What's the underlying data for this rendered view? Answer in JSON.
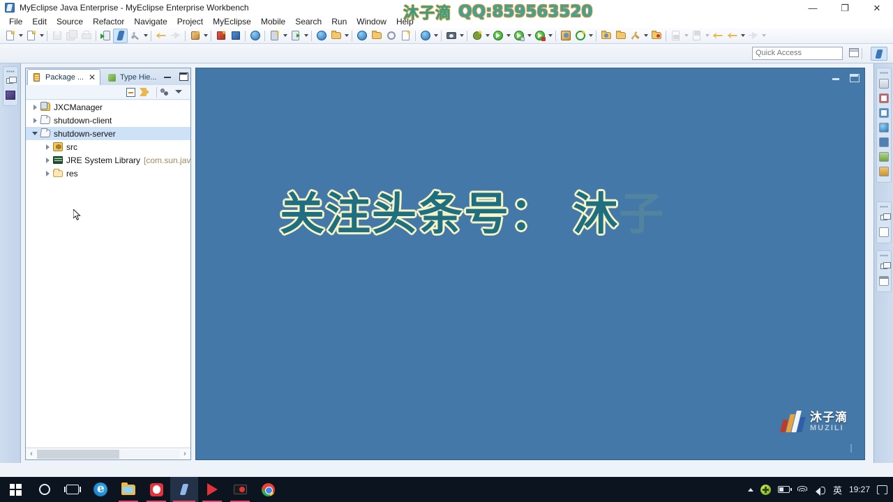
{
  "window": {
    "title": "MyEclipse Java Enterprise - MyEclipse Enterprise Workbench",
    "app_icon": "myeclipse-icon",
    "minimize": "—",
    "maximize": "❐",
    "close": "✕"
  },
  "watermark": {
    "cn": "沐子滴",
    "qq": "QQ:859563520"
  },
  "menubar": {
    "items": [
      "File",
      "Edit",
      "Source",
      "Refactor",
      "Navigate",
      "Project",
      "MyEclipse",
      "Mobile",
      "Search",
      "Run",
      "Window",
      "Help"
    ]
  },
  "toolbar": {
    "groups": [
      {
        "buttons": [
          {
            "name": "new-wizard",
            "icon": "new-file-icon",
            "caret": true,
            "selected": false,
            "disabled": false
          },
          {
            "name": "new-java-file",
            "icon": "new-doc-icon",
            "caret": true,
            "selected": false,
            "disabled": false
          }
        ]
      },
      {
        "buttons": [
          {
            "name": "save",
            "icon": "save-icon",
            "caret": false,
            "selected": false,
            "disabled": true
          },
          {
            "name": "save-all",
            "icon": "save-all-icon",
            "caret": false,
            "selected": false,
            "disabled": true
          },
          {
            "name": "print",
            "icon": "print-icon",
            "caret": false,
            "selected": false,
            "disabled": true
          }
        ]
      },
      {
        "buttons": [
          {
            "name": "run-deploy",
            "icon": "deploy-icon",
            "caret": false,
            "selected": false,
            "disabled": false
          },
          {
            "name": "myeclipse-tools",
            "icon": "myeclipse-icon",
            "caret": false,
            "selected": true,
            "disabled": false
          },
          {
            "name": "build",
            "icon": "hammer-icon",
            "caret": true,
            "selected": false,
            "disabled": false
          }
        ]
      },
      {
        "buttons": [
          {
            "name": "undo",
            "icon": "undo-arrow-icon",
            "caret": false,
            "selected": false,
            "disabled": false
          },
          {
            "name": "redo",
            "icon": "redo-arrow-icon",
            "caret": false,
            "selected": false,
            "disabled": true
          }
        ]
      },
      {
        "buttons": [
          {
            "name": "new-package",
            "icon": "package-new-icon",
            "caret": true,
            "selected": false,
            "disabled": false
          }
        ]
      },
      {
        "buttons": [
          {
            "name": "export-red",
            "icon": "package-red-icon",
            "caret": false,
            "selected": false,
            "disabled": false
          },
          {
            "name": "import-blue",
            "icon": "package-blue-icon",
            "caret": false,
            "selected": false,
            "disabled": false
          }
        ]
      },
      {
        "buttons": [
          {
            "name": "database-explorer",
            "icon": "database-icon",
            "caret": false,
            "selected": false,
            "disabled": false
          }
        ]
      },
      {
        "buttons": [
          {
            "name": "new-server",
            "icon": "server-new-icon",
            "caret": true,
            "selected": false,
            "disabled": false
          },
          {
            "name": "open-server",
            "icon": "server-icon",
            "caret": true,
            "selected": false,
            "disabled": false
          }
        ]
      },
      {
        "buttons": [
          {
            "name": "web-project",
            "icon": "web-project-icon",
            "caret": false,
            "selected": false,
            "disabled": false
          },
          {
            "name": "deploy-app",
            "icon": "deploy-app-icon",
            "caret": true,
            "selected": false,
            "disabled": false
          }
        ]
      },
      {
        "buttons": [
          {
            "name": "open-browser",
            "icon": "globe-icon",
            "caret": false,
            "selected": false,
            "disabled": false
          },
          {
            "name": "open-folder",
            "icon": "open-folder-icon",
            "caret": false,
            "selected": false,
            "disabled": false
          },
          {
            "name": "history",
            "icon": "history-icon",
            "caret": false,
            "selected": false,
            "disabled": false
          },
          {
            "name": "new-report",
            "icon": "report-icon",
            "caret": false,
            "selected": false,
            "disabled": false
          }
        ]
      },
      {
        "buttons": [
          {
            "name": "web-browser",
            "icon": "browser-globe-icon",
            "caret": true,
            "selected": false,
            "disabled": false
          }
        ]
      },
      {
        "buttons": [
          {
            "name": "snapshot",
            "icon": "camera-icon",
            "caret": true,
            "selected": false,
            "disabled": false
          }
        ]
      },
      {
        "buttons": [
          {
            "name": "debug",
            "icon": "bug-icon",
            "caret": true,
            "selected": false,
            "disabled": false
          },
          {
            "name": "run",
            "icon": "run-green-icon",
            "caret": true,
            "selected": false,
            "disabled": false
          },
          {
            "name": "run-external",
            "icon": "run-external-icon",
            "caret": true,
            "selected": false,
            "disabled": false
          },
          {
            "name": "run-server",
            "icon": "run-server-icon",
            "caret": true,
            "selected": false,
            "disabled": false
          }
        ]
      },
      {
        "buttons": [
          {
            "name": "new-class-wizard",
            "icon": "class-wizard-icon",
            "caret": false,
            "selected": false,
            "disabled": false
          },
          {
            "name": "coverage",
            "icon": "coverage-icon",
            "caret": true,
            "selected": false,
            "disabled": false
          }
        ]
      },
      {
        "buttons": [
          {
            "name": "open-type",
            "icon": "open-type-icon",
            "caret": false,
            "selected": false,
            "disabled": false
          },
          {
            "name": "open-resource",
            "icon": "open-resource-icon",
            "caret": false,
            "selected": false,
            "disabled": false
          },
          {
            "name": "search-resource",
            "icon": "search-key-icon",
            "caret": true,
            "selected": false,
            "disabled": false
          },
          {
            "name": "open-task",
            "icon": "open-task-icon",
            "caret": false,
            "selected": false,
            "disabled": false
          }
        ]
      },
      {
        "buttons": [
          {
            "name": "next-annotation",
            "icon": "next-annotation-icon",
            "caret": true,
            "selected": false,
            "disabled": true
          },
          {
            "name": "prev-annotation",
            "icon": "prev-annotation-icon",
            "caret": true,
            "selected": false,
            "disabled": true
          },
          {
            "name": "back",
            "icon": "back-arrow-icon",
            "caret": false,
            "selected": false,
            "disabled": false
          },
          {
            "name": "forward-history",
            "icon": "forward-arrow-icon",
            "caret": true,
            "selected": false,
            "disabled": false
          },
          {
            "name": "forward",
            "icon": "next-arrow-icon",
            "caret": true,
            "selected": false,
            "disabled": true
          }
        ]
      }
    ]
  },
  "quick_access": {
    "placeholder": "Quick Access",
    "value": "",
    "open_perspective_label": "open-perspective",
    "perspective_myeclipse_label": "MyEclipse Java Enterprise"
  },
  "package_explorer": {
    "tabs": [
      {
        "label": "Package ...",
        "icon": "package-explorer-icon",
        "active": true,
        "closable": true
      },
      {
        "label": "Type Hie...",
        "icon": "type-hierarchy-icon",
        "active": false,
        "closable": false
      }
    ],
    "view_toolbar": [
      {
        "name": "collapse-all-button",
        "icon": "collapse-all-icon"
      },
      {
        "name": "link-with-editor-button",
        "icon": "link-editor-icon"
      },
      {
        "name": "focus-on-active-task-button",
        "icon": "focus-task-icon"
      },
      {
        "name": "view-menu-button",
        "icon": "view-menu-icon"
      }
    ],
    "window_buttons": [
      {
        "name": "minimize-view-button",
        "icon": "minimize-icon"
      },
      {
        "name": "maximize-view-button",
        "icon": "maximize-icon"
      }
    ],
    "tree": [
      {
        "label": "JXCManager",
        "icon": "java-project-icon",
        "state": "collapsed",
        "level": 0,
        "selected": false,
        "suffix": ""
      },
      {
        "label": "shutdown-client",
        "icon": "project-icon",
        "state": "collapsed",
        "level": 0,
        "selected": false,
        "suffix": ""
      },
      {
        "label": "shutdown-server",
        "icon": "project-icon",
        "state": "expanded",
        "level": 0,
        "selected": true,
        "suffix": ""
      },
      {
        "label": "src",
        "icon": "source-folder-icon",
        "state": "collapsed",
        "level": 1,
        "selected": false,
        "suffix": ""
      },
      {
        "label": "JRE System Library",
        "icon": "jre-library-icon",
        "state": "collapsed",
        "level": 1,
        "selected": false,
        "suffix": "[com.sun.jav"
      },
      {
        "label": "res",
        "icon": "folder-icon",
        "state": "collapsed",
        "level": 1,
        "selected": false,
        "suffix": ""
      }
    ],
    "hscroll": {
      "left_arrow": "‹",
      "right_arrow": "›"
    }
  },
  "editor": {
    "background_color": "#4478a8",
    "overlay_text_solid": "关注头条号： 沐",
    "overlay_text_faded": "子",
    "window_buttons": [
      {
        "name": "minimize-editor-button",
        "icon": "minimize-icon"
      },
      {
        "name": "maximize-editor-button",
        "icon": "maximize-icon"
      }
    ]
  },
  "brand_logo": {
    "cn": "沐子滴",
    "en": "MUZILI"
  },
  "left_rail": {
    "items": [
      {
        "name": "restore-view-button",
        "icon": "restore-icon"
      },
      {
        "name": "package-explorer-rail-button",
        "icon": "package-explorer-icon"
      }
    ]
  },
  "right_rail": {
    "groups": [
      {
        "items": [
          {
            "name": "outline-rail-button",
            "icon": "outline-icon",
            "color": "#b0b8c4"
          },
          {
            "name": "problems-rail-button",
            "icon": "problems-icon",
            "color": "#e0e8f2"
          },
          {
            "name": "tasks-rail-button",
            "icon": "tasks-icon",
            "color": "#dcecf8"
          },
          {
            "name": "servers-rail-button",
            "icon": "servers-globe-icon",
            "color": "#4e8fd6"
          },
          {
            "name": "console-rail-button",
            "icon": "console-icon",
            "color": "#5a8fc4"
          },
          {
            "name": "properties-rail-button",
            "icon": "properties-icon",
            "color": "#8fbc5a"
          },
          {
            "name": "snippets-rail-button",
            "icon": "snippets-icon",
            "color": "#e0a040"
          }
        ]
      },
      {
        "items": [
          {
            "name": "restore-right-button",
            "icon": "restore-icon",
            "color": "#c4ccd6"
          },
          {
            "name": "outline-view-button",
            "icon": "outline-list-icon",
            "color": "#6d8096"
          }
        ]
      },
      {
        "items": [
          {
            "name": "restore-bottom-button",
            "icon": "restore-icon",
            "color": "#c4ccd6"
          },
          {
            "name": "view-grid-button",
            "icon": "grid-icon",
            "color": "#9aa6b4"
          }
        ]
      }
    ]
  },
  "taskbar": {
    "start": {
      "name": "start-button",
      "icon": "windows-logo-icon"
    },
    "items": [
      {
        "name": "cortana-search-button",
        "icon": "cortana-circle-icon",
        "state": "idle"
      },
      {
        "name": "task-view-button",
        "icon": "task-view-icon",
        "state": "idle"
      },
      {
        "name": "edge-button",
        "icon": "edge-icon",
        "state": "idle"
      },
      {
        "name": "file-explorer-button",
        "icon": "file-explorer-icon",
        "state": "open"
      },
      {
        "name": "qq-button",
        "icon": "qq-icon",
        "state": "open"
      },
      {
        "name": "myeclipse-button",
        "icon": "myeclipse-icon",
        "state": "active"
      },
      {
        "name": "play-store-button",
        "icon": "play-triangle-icon",
        "state": "open"
      },
      {
        "name": "screen-recorder-button",
        "icon": "recorder-icon",
        "state": "open"
      },
      {
        "name": "chrome-button",
        "icon": "chrome-icon",
        "state": "idle"
      }
    ],
    "tray": {
      "show_hidden": {
        "name": "show-hidden-icons-button",
        "icon": "chevron-up-icon"
      },
      "items": [
        {
          "name": "security-tray-icon",
          "icon": "security-shield-icon"
        },
        {
          "name": "battery-tray-icon",
          "icon": "battery-icon"
        },
        {
          "name": "network-tray-icon",
          "icon": "wifi-icon"
        },
        {
          "name": "volume-tray-icon",
          "icon": "speaker-icon"
        }
      ],
      "ime": "英",
      "clock": "19:27",
      "action_center": {
        "name": "action-center-button",
        "icon": "notification-icon"
      }
    }
  }
}
